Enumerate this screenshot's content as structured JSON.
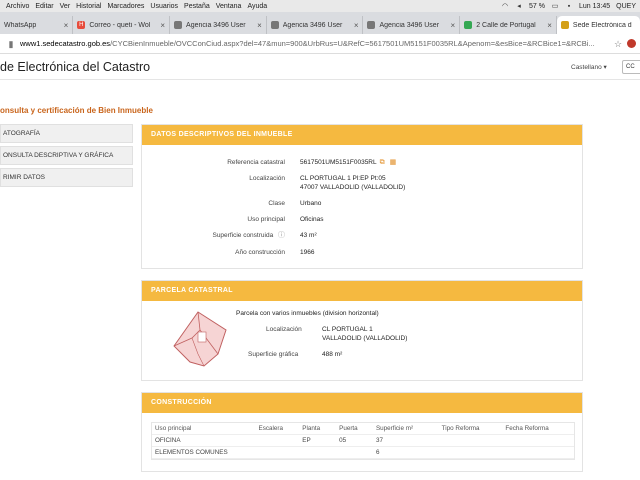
{
  "menubar": {
    "items": [
      "Archivo",
      "Editar",
      "Ver",
      "Historial",
      "Marcadores",
      "Usuarios",
      "Pestaña",
      "Ventana",
      "Ayuda"
    ],
    "battery": "57 %",
    "clock": "Lun 13:45",
    "user": "QUEY"
  },
  "tabs": [
    {
      "label": "WhatsApp",
      "color": "#25d366"
    },
    {
      "label": "Correo - queti - Wol",
      "color": "#e74c3c"
    },
    {
      "label": "Agencia 3496 User",
      "color": "#555555"
    },
    {
      "label": "Agencia 3496 User",
      "color": "#555555"
    },
    {
      "label": "Agencia 3496 User",
      "color": "#555555"
    },
    {
      "label": "2 Calle de Portugal",
      "color": "#34a853"
    },
    {
      "label": "Sede Electrónica d",
      "color": "#d4a017"
    }
  ],
  "address": {
    "host": "www1.sedecatastro.gob.es",
    "path": "/CYCBienInmueble/OVCConCiud.aspx?del=47&mun=900&UrbRus=U&RefC=5617501UM5151F0035RL&Apenom=&esBice=&RCBice1=&RCBi..."
  },
  "site": {
    "title": "de Electrónica del Catastro",
    "language": "Castellano",
    "lang_button": "CC"
  },
  "section_title": "onsulta y certificación de Bien Inmueble",
  "left_menu": [
    "ATOGRAFÍA",
    "ONSULTA DESCRIPTIVA Y GRÁFICA",
    "RIMIR DATOS"
  ],
  "datos": {
    "header": "DATOS DESCRIPTIVOS DEL INMUEBLE",
    "rows": [
      {
        "label": "Referencia catastral",
        "value": "5617501UM5151F0035RL"
      },
      {
        "label": "Localización",
        "value": "CL PORTUGAL 1 Pl:EP Pt:05"
      },
      {
        "label": "",
        "value": "47007 VALLADOLID (VALLADOLID)"
      },
      {
        "label": "Clase",
        "value": "Urbano"
      },
      {
        "label": "Uso principal",
        "value": "Oficinas"
      },
      {
        "label": "Superficie construida",
        "value": "43 m²"
      },
      {
        "label": "Año construcción",
        "value": "1966"
      }
    ]
  },
  "parcela": {
    "header": "PARCELA CATASTRAL",
    "subtitle": "Parcela con varios inmuebles (division horizontal)",
    "loc_label": "Localización",
    "loc_line1": "CL PORTUGAL 1",
    "loc_line2": "VALLADOLID (VALLADOLID)",
    "surface_label": "Superficie gráfica",
    "surface_value": "488 m²"
  },
  "construccion": {
    "header": "CONSTRUCCIÓN",
    "columns": [
      "Uso principal",
      "Escalera",
      "Planta",
      "Puerta",
      "Superficie m²",
      "Tipo Reforma",
      "Fecha Reforma"
    ],
    "rows": [
      [
        "OFICINA",
        "",
        "EP",
        "05",
        "37",
        "",
        ""
      ],
      [
        "ELEMENTOS COMUNES",
        "",
        "",
        "",
        "6",
        "",
        ""
      ]
    ]
  },
  "colors": {
    "accent": "#f5b940",
    "title_orange": "#c9651c"
  }
}
